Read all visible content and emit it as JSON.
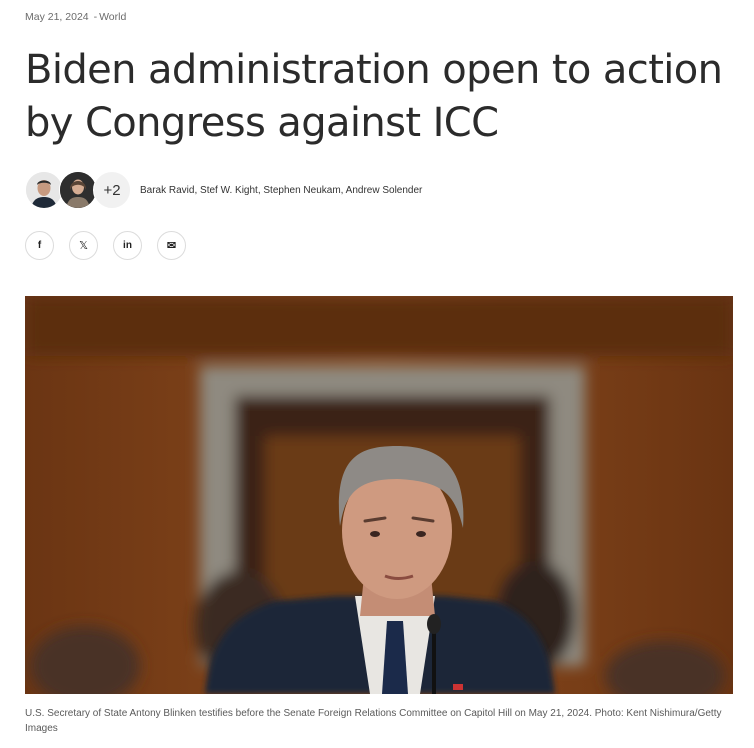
{
  "article": {
    "date": "May 21, 2024",
    "date_separator": "-",
    "section": "World",
    "headline": "Biden administration open to action by Congress against ICC",
    "authors": {
      "extra_count": "+2",
      "names": "Barak Ravid, Stef W. Kight, Stephen Neukam, Andrew Solender"
    },
    "share": [
      {
        "name": "facebook-icon",
        "glyph": "f"
      },
      {
        "name": "x-icon",
        "glyph": "𝕏"
      },
      {
        "name": "linkedin-icon",
        "glyph": "in"
      },
      {
        "name": "email-icon",
        "glyph": "✉"
      }
    ],
    "photo_caption": "U.S. Secretary of State Antony Blinken testifies before the Senate Foreign Relations Committee on Capitol Hill on May 21, 2024. Photo: Kent Nishimura/Getty Images"
  }
}
